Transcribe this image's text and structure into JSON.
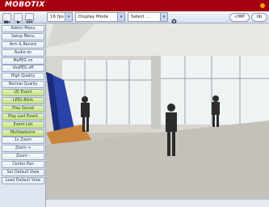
{
  "app": {
    "brand": "MOBOTIX",
    "status_color": "#f2a800",
    "brand_color": "#a50010"
  },
  "toolbar": {
    "resolution": "16 fps",
    "display_mode": "Display Mode",
    "select": "Select ...",
    "icons": [
      "cam-icon",
      "play-icon",
      "grid-icon",
      "gear-icon"
    ],
    "right_buttons": [
      "<MP",
      "lib"
    ]
  },
  "sidebar": {
    "items": [
      {
        "label": "Admin Menu",
        "style": "white"
      },
      {
        "label": "Setup Menu",
        "style": "white"
      },
      {
        "label": "Arm & Record",
        "style": "white"
      },
      {
        "label": "Audio on",
        "style": "white"
      },
      {
        "label": "MxPEG on",
        "style": "white"
      },
      {
        "label": "VoxPEG off",
        "style": "white"
      },
      {
        "label": "High Quality",
        "style": "white"
      },
      {
        "label": "Normal Quality",
        "style": "white"
      },
      {
        "label": "UC Event",
        "style": "green"
      },
      {
        "label": "LEDs Blink",
        "style": "green"
      },
      {
        "label": "Play Sound",
        "style": "green"
      },
      {
        "label": "Play Last Event",
        "style": "green"
      },
      {
        "label": "Event List",
        "style": "green"
      },
      {
        "label": "Multiselector",
        "style": "green"
      },
      {
        "label": "1x Zoom",
        "style": "white"
      },
      {
        "label": "Zoom +",
        "style": "white"
      },
      {
        "label": "Zoom -",
        "style": "white"
      },
      {
        "label": "Center Pan",
        "style": "white"
      },
      {
        "label": "Set Default View",
        "style": "white"
      },
      {
        "label": "Load Default View",
        "style": "white"
      }
    ]
  }
}
